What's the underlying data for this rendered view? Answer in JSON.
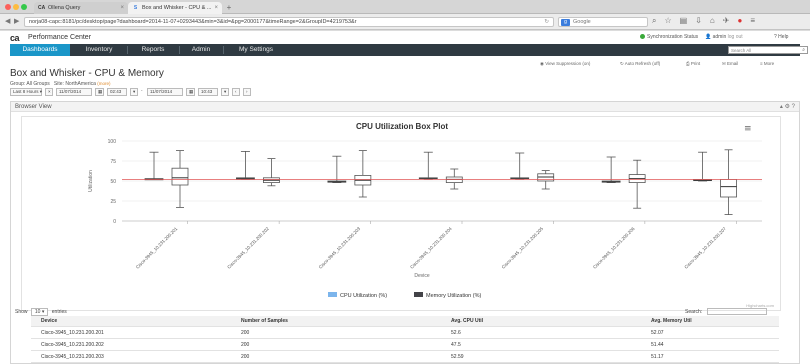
{
  "browser": {
    "tabs": [
      {
        "title": "CA",
        "label": "Ollena Query",
        "active": false
      },
      {
        "title": "S",
        "label": "Box and Whisker - CPU & ...",
        "active": true
      }
    ],
    "url": "norja08-capc:8181/pc/desktop/page?dashboard=2014-11-07+0293443&min=3&id=&pg=2000177&timeRange=2&GroupID=4219753&r",
    "search_engine": "Google",
    "search_placeholder": "Google"
  },
  "app": {
    "logo": "ca",
    "title": "Performance Center",
    "status_label": "Synchronization Status",
    "user_label": "admin",
    "logout_label": "log out",
    "help_label": "Help"
  },
  "nav": {
    "items": [
      "Dashboards",
      "Inventory",
      "Reports",
      "Admin",
      "My Settings"
    ],
    "active": "Dashboards",
    "search_placeholder": "Search All"
  },
  "page": {
    "title": "Box and Whisker - CPU & Memory",
    "group_label": "Group: All Groups",
    "site_label": "Site: NorthAmerica",
    "site_note": "(more)",
    "actions": [
      "View Suppression (on)",
      "Auto Refresh (off)",
      "Print",
      "Email",
      "More"
    ],
    "filters": {
      "range": "Last 8 Hours",
      "start_date": "11/07/2014",
      "start_time": "02:43",
      "end_date": "11/07/2014",
      "end_time": "10:43"
    },
    "view_title": "Browser View"
  },
  "chart_data": {
    "type": "box",
    "title": "CPU Utilization Box Plot",
    "xlabel": "Device",
    "ylabel": "Utilization",
    "ylim": [
      0,
      100
    ],
    "yticks": [
      0,
      25,
      50,
      75,
      100
    ],
    "categories": [
      "Cisco-3945_10.231.200.201",
      "Cisco-3945_10.231.200.202",
      "Cisco-3945_10.231.200.203",
      "Cisco-3945_10.231.200.204",
      "Cisco-3945_10.231.200.205",
      "Cisco-3945_10.231.200.206",
      "Cisco-3945_10.231.200.207"
    ],
    "series": [
      {
        "name": "CPU Utilization (%)",
        "color": "#7cb5ec",
        "boxes": [
          {
            "low": 52,
            "q1": 52,
            "median": 52,
            "q3": 53,
            "high": 86
          },
          {
            "low": 52,
            "q1": 52,
            "median": 53,
            "q3": 54,
            "high": 87
          },
          {
            "low": 48,
            "q1": 49,
            "median": 49,
            "q3": 50,
            "high": 81
          },
          {
            "low": 52,
            "q1": 53,
            "median": 53,
            "q3": 54,
            "high": 86
          },
          {
            "low": 52,
            "q1": 53,
            "median": 53,
            "q3": 54,
            "high": 85
          },
          {
            "low": 48,
            "q1": 49,
            "median": 49,
            "q3": 50,
            "high": 80
          },
          {
            "low": 50,
            "q1": 51,
            "median": 51,
            "q3": 52,
            "high": 86
          }
        ]
      },
      {
        "name": "Memory Utilization (%)",
        "color": "#434348",
        "boxes": [
          {
            "low": 17,
            "q1": 45,
            "median": 54,
            "q3": 66,
            "high": 88
          },
          {
            "low": 44,
            "q1": 48,
            "median": 51,
            "q3": 54,
            "high": 78
          },
          {
            "low": 30,
            "q1": 45,
            "median": 51,
            "q3": 57,
            "high": 88
          },
          {
            "low": 40,
            "q1": 48,
            "median": 52,
            "q3": 55,
            "high": 65
          },
          {
            "low": 40,
            "q1": 50,
            "median": 55,
            "q3": 59,
            "high": 63
          },
          {
            "low": 16,
            "q1": 48,
            "median": 53,
            "q3": 58,
            "high": 76
          },
          {
            "low": 8,
            "q1": 30,
            "median": 43,
            "q3": 52,
            "high": 89
          }
        ]
      }
    ],
    "reference_line": {
      "value": 52,
      "color": "#e05555"
    },
    "legend_position": "bottom",
    "credit": "Highcharts.com"
  },
  "table": {
    "show_label": "Show",
    "page_size": "10",
    "entries_label": "entries",
    "search_label": "Search:",
    "columns": [
      "Device",
      "Number of Samples",
      "Avg. CPU Util",
      "Avg. Memory Util"
    ],
    "rows": [
      [
        "Cisco-3945_10.231.200.201",
        "200",
        "52.6",
        "52.07"
      ],
      [
        "Cisco-3945_10.231.200.202",
        "200",
        "47.5",
        "51.44"
      ],
      [
        "Cisco-3945_10.231.200.203",
        "200",
        "52.59",
        "51.17"
      ]
    ]
  },
  "colors": {
    "nav_bg": "#2f3a42",
    "nav_active": "#1a96c8",
    "cpu": "#7cb5ec",
    "memory": "#434348",
    "reference": "#e05555"
  }
}
